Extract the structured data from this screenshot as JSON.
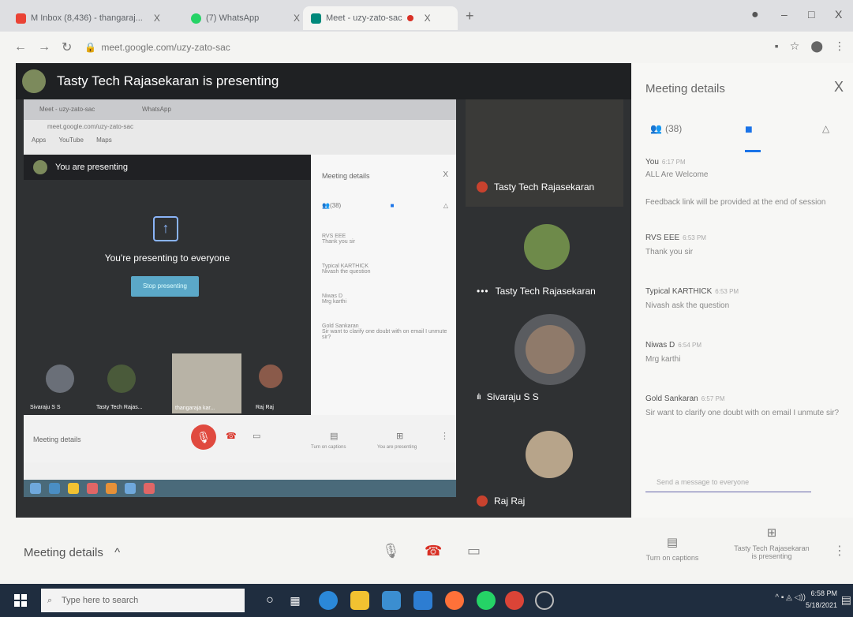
{
  "browser": {
    "tabs": [
      {
        "label": "M Inbox (8,436) - thangaraj...",
        "x": "",
        "close": "X"
      },
      {
        "label": "(7) WhatsApp",
        "close": "X"
      },
      {
        "label": "Meet - uzy-zato-sac",
        "close": "X"
      }
    ],
    "new_tab": "+",
    "url": "meet.google.com/uzy-zato-sac",
    "window_controls": [
      "–",
      "□",
      "X"
    ]
  },
  "stage": {
    "presenter_banner": "Tasty Tech Rajasekaran is presenting",
    "shared_screen": {
      "tabs": [
        "Meet - uzy-zato-sac",
        "WhatsApp"
      ],
      "url": "meet.google.com/uzy-zato-sac",
      "bookmarks": [
        "Apps",
        "YouTube",
        "Maps"
      ],
      "presenting_banner": "You are presenting",
      "presenting_to": "You're presenting to everyone",
      "stop_button": "Stop presenting",
      "tiles": [
        "Sivaraju S S",
        "Tasty Tech Rajas...",
        "thangaraja kar...",
        "Raj Raj"
      ],
      "details_title": "Meeting details",
      "details_close": "X",
      "participants_count": "(38)",
      "chat": [
        {
          "who": "RVS EEE",
          "text": "Thank you sir"
        },
        {
          "who": "Typical KARTHICK",
          "text": "Nivash the question"
        },
        {
          "who": "Niwas D",
          "text": "Mrg karthi"
        },
        {
          "who": "Gold Sankaran",
          "text": "Sir want to clarify one doubt with on email I unmute sir?"
        }
      ],
      "bottom_label": "Meeting details",
      "captions": "Turn on captions",
      "presenting": "You are presenting"
    },
    "participants": [
      {
        "name": "Tasty Tech Rajasekaran"
      },
      {
        "name": "Tasty Tech Rajasekaran"
      },
      {
        "name": "Sivaraju S S"
      },
      {
        "name": "Raj Raj"
      }
    ]
  },
  "panel": {
    "title": "Meeting details",
    "close": "X",
    "participants_count": "(38)",
    "messages": [
      {
        "who": "You",
        "time": "6:17 PM",
        "text": "ALL Are Welcome"
      },
      {
        "who": "",
        "time": "",
        "text": "Feedback link will be provided at the end of session"
      },
      {
        "who": "RVS EEE",
        "time": "6:53 PM",
        "text": "Thank you sir"
      },
      {
        "who": "Typical KARTHICK",
        "time": "6:53 PM",
        "text": "Nivash ask the question"
      },
      {
        "who": "Niwas D",
        "time": "6:54 PM",
        "text": "Mrg karthi"
      },
      {
        "who": "Gold Sankaran",
        "time": "6:57 PM",
        "text": "Sir want to clarify one doubt with on email I unmute sir?"
      }
    ],
    "input_placeholder": "Send a message to everyone",
    "bottom": {
      "captions": "Turn on captions",
      "presenting_line1": "Tasty Tech Rajasekaran",
      "presenting_line2": "is presenting"
    }
  },
  "toolbar": {
    "meeting_details": "Meeting details",
    "chevron": "^"
  },
  "taskbar": {
    "search_placeholder": "Type here to search",
    "time": "6:58 PM",
    "date": "5/18/2021"
  },
  "colors": {
    "stage_bg": "#2f3133",
    "accent": "#1a73e8",
    "hangup": "#d93025",
    "taskbar": "#1f2d3f"
  }
}
